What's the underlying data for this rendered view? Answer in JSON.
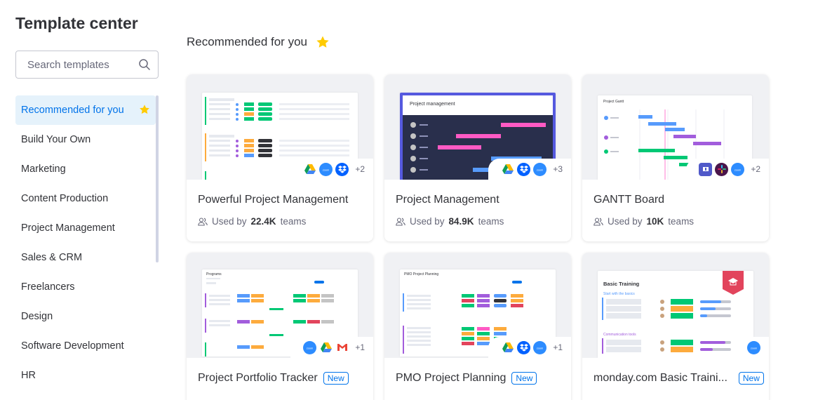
{
  "sidebar": {
    "title": "Template center",
    "search_placeholder": "Search templates",
    "items": [
      {
        "label": "Recommended for you",
        "active": true
      },
      {
        "label": "Build Your Own"
      },
      {
        "label": "Marketing"
      },
      {
        "label": "Content Production"
      },
      {
        "label": "Project Management"
      },
      {
        "label": "Sales & CRM"
      },
      {
        "label": "Freelancers"
      },
      {
        "label": "Design"
      },
      {
        "label": "Software Development"
      },
      {
        "label": "HR"
      }
    ]
  },
  "main": {
    "section_title": "Recommended for you",
    "cards": [
      {
        "title": "Powerful Project Management",
        "used_prefix": "Used by",
        "count": "22.4K",
        "used_suffix": "teams",
        "more": "+2",
        "apps": [
          "gdrive",
          "zoom",
          "dropbox"
        ]
      },
      {
        "title": "Project Management",
        "used_prefix": "Used by",
        "count": "84.9K",
        "used_suffix": "teams",
        "more": "+3",
        "apps": [
          "gdrive",
          "dropbox",
          "zoom"
        ],
        "preview_title": "Project management"
      },
      {
        "title": "GANTT Board",
        "used_prefix": "Used by",
        "count": "10K",
        "used_suffix": "teams",
        "more": "+2",
        "apps": [
          "teams",
          "slack",
          "zoom"
        ],
        "preview_title": "Project Gantt"
      },
      {
        "title": "Project Portfolio Tracker",
        "badge": "New",
        "more": "+1",
        "apps": [
          "zoom",
          "gdrive",
          "gmail"
        ],
        "preview_title": "Programs"
      },
      {
        "title": "PMO Project Planning",
        "badge": "New",
        "more": "+1",
        "apps": [
          "gdrive",
          "dropbox",
          "zoom"
        ],
        "preview_title": "PMO Project Planning"
      },
      {
        "title": "monday.com Basic Traini...",
        "badge": "New",
        "more": "",
        "apps": [
          "zoom"
        ],
        "preview_title": "Basic Training",
        "preview_sub1": "Start with the basics",
        "preview_sub2": "Communication tools"
      }
    ]
  },
  "colors": {
    "accent": "#0073ea",
    "active_bg": "#e5f2fb",
    "star": "#ffcb00",
    "green": "#00c875",
    "orange": "#fdab3d",
    "red": "#e2445c",
    "purple": "#a25ddc",
    "pink": "#ff5ac4",
    "blue": "#579bfc",
    "pm_header": "#5559df",
    "pm_body": "#292f4c"
  }
}
